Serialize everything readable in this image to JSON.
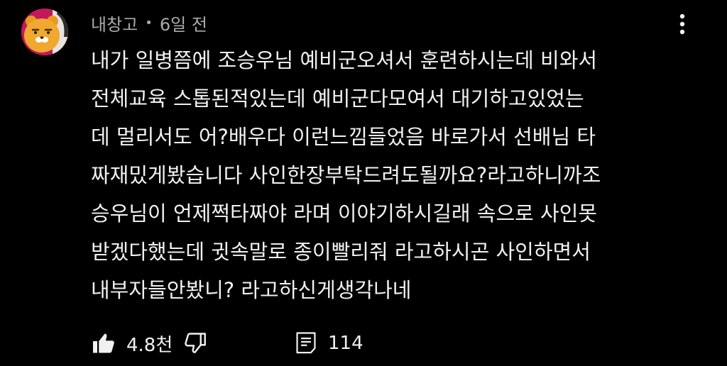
{
  "comment": {
    "author": "내창고",
    "separator": "•",
    "time": "6일 전",
    "lines": [
      "내가 일병쯤에 조승우님 예비군오셔서 훈련하시는데 비와서",
      "전체교육 스톱된적있는데 예비군다모여서 대기하고있었는",
      "데 멀리서도 어?배우다 이런느낌들었음 바로가서 선배님 타",
      "짜재밌게봤습니다 사인한장부탁드려도될까요?라고하니까조",
      "승우님이 언제쩍타짜야 라며 이야기하시길래 속으로 사인못",
      "받겠다했는데 귓속말로 종이빨리줘 라고하시곤 사인하면서",
      "내부자들안봤니? 라고하신게생각나네"
    ],
    "likes": "4.8천",
    "replies": "114"
  },
  "icons": {
    "avatar": "ryan-character-avatar",
    "menu": "more-vertical-icon",
    "like": "thumbs-up-filled-icon",
    "dislike": "thumbs-down-outline-icon",
    "reply": "reply-comment-icon"
  },
  "colors": {
    "background": "#000000",
    "text": "#f1f1f1",
    "meta": "#aaaaaa",
    "avatar_bg": "#c2185b",
    "avatar_face": "#f0a92e"
  }
}
